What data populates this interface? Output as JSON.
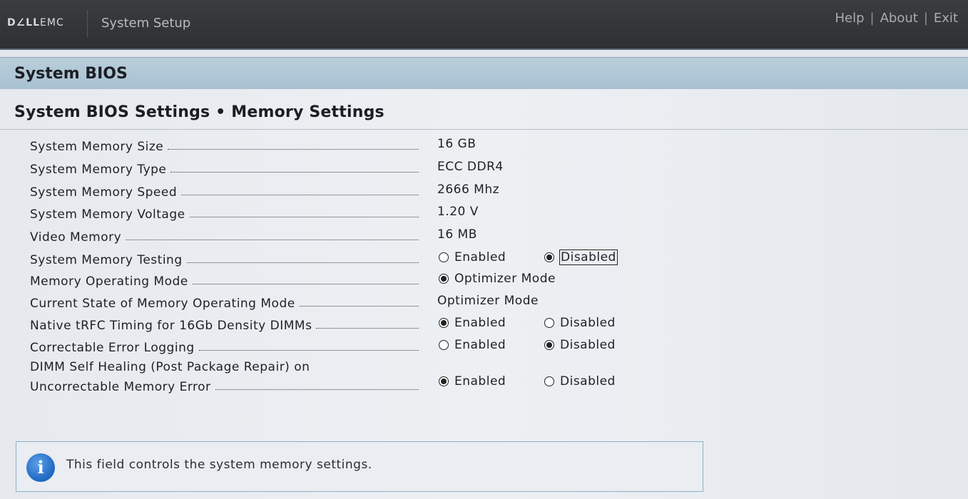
{
  "header": {
    "brand_dell": "D∠LL",
    "brand_emc": "EMC",
    "app_title": "System Setup",
    "links": {
      "help": "Help",
      "about": "About",
      "exit": "Exit",
      "separator": "|"
    }
  },
  "section": {
    "title": "System BIOS"
  },
  "page": {
    "title": "System BIOS Settings • Memory Settings",
    "rows": {
      "memory_size": {
        "label": "System Memory Size",
        "value": "16 GB"
      },
      "memory_type": {
        "label": "System Memory Type",
        "value": "ECC DDR4"
      },
      "memory_speed": {
        "label": "System Memory Speed",
        "value": "2666 Mhz"
      },
      "memory_voltage": {
        "label": "System Memory Voltage",
        "value": "1.20 V"
      },
      "video_memory": {
        "label": "Video Memory",
        "value": "16 MB"
      },
      "memory_testing": {
        "label": "System Memory Testing",
        "opt1": "Enabled",
        "opt2": "Disabled",
        "selected": "Disabled"
      },
      "operating_mode": {
        "label": "Memory Operating Mode",
        "opt1": "Optimizer Mode",
        "selected": "Optimizer Mode"
      },
      "current_state": {
        "label": "Current State of Memory Operating Mode",
        "value": "Optimizer Mode"
      },
      "native_trfc": {
        "label": "Native tRFC Timing for 16Gb Density DIMMs",
        "opt1": "Enabled",
        "opt2": "Disabled",
        "selected": "Enabled"
      },
      "error_logging": {
        "label": "Correctable Error Logging",
        "opt1": "Enabled",
        "opt2": "Disabled",
        "selected": "Disabled"
      },
      "self_healing": {
        "label_line1": "DIMM Self Healing (Post Package Repair) on",
        "label_line2": "Uncorrectable Memory Error",
        "opt1": "Enabled",
        "opt2": "Disabled",
        "selected": "Enabled"
      }
    }
  },
  "help": {
    "text": "This field controls the system memory settings.",
    "icon": "info-icon"
  }
}
